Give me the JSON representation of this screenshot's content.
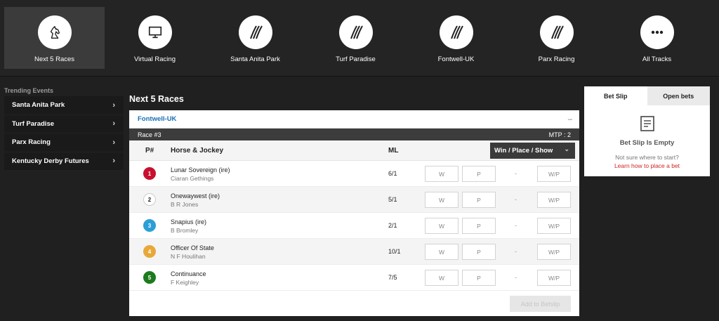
{
  "nav": [
    {
      "label": "Next 5 Races",
      "icon": "horse-head-icon",
      "active": true
    },
    {
      "label": "Virtual Racing",
      "icon": "monitor-icon"
    },
    {
      "label": "Santa Anita Park",
      "icon": "racetrack-icon"
    },
    {
      "label": "Turf Paradise",
      "icon": "racetrack-icon"
    },
    {
      "label": "Fontwell-UK",
      "icon": "racetrack-icon"
    },
    {
      "label": "Parx Racing",
      "icon": "racetrack-icon"
    },
    {
      "label": "All Tracks",
      "icon": "more-dots-icon"
    }
  ],
  "sidebar": {
    "title": "Trending Events",
    "items": [
      {
        "label": "Santa Anita Park"
      },
      {
        "label": "Turf Paradise"
      },
      {
        "label": "Parx Racing"
      },
      {
        "label": "Kentucky Derby Futures"
      }
    ]
  },
  "main": {
    "title": "Next 5 Races",
    "track": "Fontwell-UK",
    "collapse": "–",
    "race": "Race #3",
    "mtp": "MTP : 2",
    "columns": {
      "pnum": "P#",
      "horse": "Horse & Jockey",
      "ml": "ML",
      "bet_type": "Win / Place / Show"
    },
    "bet_labels": {
      "w": "W",
      "p": "P",
      "dash": "-",
      "wp": "W/P"
    },
    "runners": [
      {
        "num": "1",
        "horse": "Lunar Sovereign (ire)",
        "jockey": "Ciaran Gethings",
        "ml": "6/1",
        "bg": "#c8102e",
        "fg": "#ffffff"
      },
      {
        "num": "2",
        "horse": "Onewaywest (ire)",
        "jockey": "B R Jones",
        "ml": "5/1",
        "bg": "#ffffff",
        "fg": "#222222"
      },
      {
        "num": "3",
        "horse": "Snapius (ire)",
        "jockey": "B Bromley",
        "ml": "2/1",
        "bg": "#2a9fd6",
        "fg": "#ffffff"
      },
      {
        "num": "4",
        "horse": "Officer Of State",
        "jockey": "N F Houlihan",
        "ml": "10/1",
        "bg": "#e8a838",
        "fg": "#ffffff"
      },
      {
        "num": "5",
        "horse": "Continuance",
        "jockey": "F Keighley",
        "ml": "7/5",
        "bg": "#1d7a1d",
        "fg": "#ffffff"
      }
    ],
    "add_button": "Add to Betslip"
  },
  "betslip": {
    "tab_active": "Bet Slip",
    "tab_other": "Open bets",
    "empty_title": "Bet Slip Is Empty",
    "hint": "Not sure where to start?",
    "link": "Learn how to place a bet"
  }
}
